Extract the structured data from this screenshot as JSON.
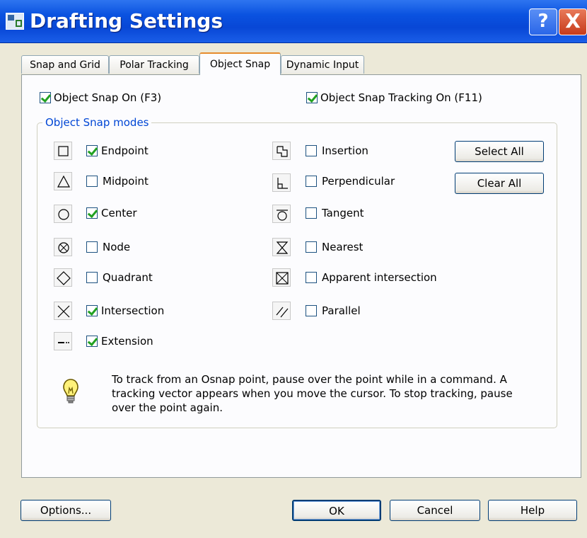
{
  "window": {
    "title": "Drafting Settings",
    "help_button": "?",
    "close_button": "X"
  },
  "tabs": [
    {
      "label": "Snap and Grid",
      "active": false
    },
    {
      "label": "Polar Tracking",
      "active": false
    },
    {
      "label": "Object Snap",
      "active": true
    },
    {
      "label": "Dynamic Input",
      "active": false
    }
  ],
  "toggles": {
    "snap_on": {
      "label": "Object Snap On (F3)",
      "checked": true
    },
    "tracking_on": {
      "label": "Object Snap Tracking On (F11)",
      "checked": true
    }
  },
  "modes": {
    "group_title": "Object Snap modes",
    "left": [
      {
        "label": "Endpoint",
        "checked": true,
        "icon": "endpoint-icon"
      },
      {
        "label": "Midpoint",
        "checked": false,
        "icon": "midpoint-icon"
      },
      {
        "label": "Center",
        "checked": true,
        "icon": "center-icon"
      },
      {
        "label": "Node",
        "checked": false,
        "icon": "node-icon"
      },
      {
        "label": "Quadrant",
        "checked": false,
        "icon": "quadrant-icon"
      },
      {
        "label": "Intersection",
        "checked": true,
        "icon": "intersection-icon"
      },
      {
        "label": "Extension",
        "checked": true,
        "icon": "extension-icon"
      }
    ],
    "right": [
      {
        "label": "Insertion",
        "checked": false,
        "icon": "insertion-icon"
      },
      {
        "label": "Perpendicular",
        "checked": false,
        "icon": "perpendicular-icon"
      },
      {
        "label": "Tangent",
        "checked": false,
        "icon": "tangent-icon"
      },
      {
        "label": "Nearest",
        "checked": false,
        "icon": "nearest-icon"
      },
      {
        "label": "Apparent intersection",
        "checked": false,
        "icon": "apparent-intersection-icon"
      },
      {
        "label": "Parallel",
        "checked": false,
        "icon": "parallel-icon"
      }
    ],
    "select_all": "Select All",
    "clear_all": "Clear All"
  },
  "tip": {
    "icon": "lightbulb-icon",
    "text": "To track from an Osnap point, pause over the point while in a command.  A tracking vector appears when you move the cursor.  To stop tracking, pause over the point again."
  },
  "footer": {
    "options": "Options...",
    "ok": "OK",
    "cancel": "Cancel",
    "help": "Help"
  }
}
